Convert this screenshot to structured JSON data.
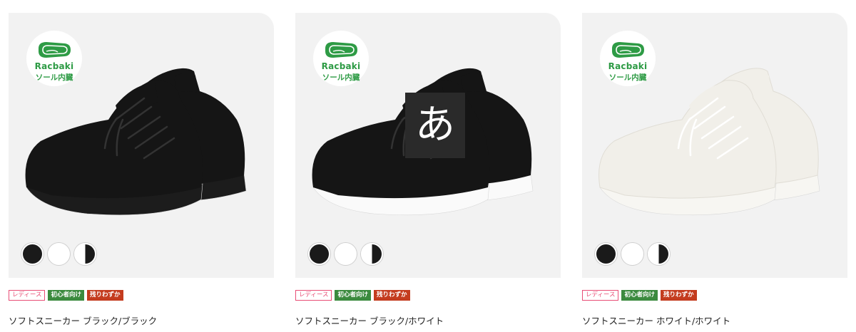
{
  "products": [
    {
      "badge": {
        "brand": "Racbaki",
        "sub": "ソール内臓"
      },
      "upper_color": "#151515",
      "sole_color": "#1c1c1c",
      "lace_color": "#333333",
      "swatches": [
        "black",
        "white",
        "white-black"
      ],
      "tags": [
        "レディース",
        "初心者向け",
        "残りわずか"
      ],
      "title": "ソフトスニーカー ブラック/ブラック"
    },
    {
      "badge": {
        "brand": "Racbaki",
        "sub": "ソール内臓"
      },
      "upper_color": "#151515",
      "sole_color": "#fafafa",
      "lace_color": "#333333",
      "swatches": [
        "black",
        "white",
        "white-black"
      ],
      "tags": [
        "レディース",
        "初心者向け",
        "残りわずか"
      ],
      "title": "ソフトスニーカー ブラック/ホワイト"
    },
    {
      "badge": {
        "brand": "Racbaki",
        "sub": "ソール内臓"
      },
      "upper_color": "#f1efe9",
      "sole_color": "#f7f6f2",
      "lace_color": "#ffffff",
      "swatches": [
        "black",
        "white",
        "white-black"
      ],
      "tags": [
        "レディース",
        "初心者向け",
        "残りわずか"
      ],
      "title": "ソフトスニーカー ホワイト/ホワイト"
    }
  ],
  "ime_overlay": {
    "char": "あ"
  },
  "colors": {
    "badge_green": "#2e9b45",
    "tag_pink": "#e84d76",
    "tag_green": "#3b8a3e",
    "tag_red": "#c43c1f"
  }
}
